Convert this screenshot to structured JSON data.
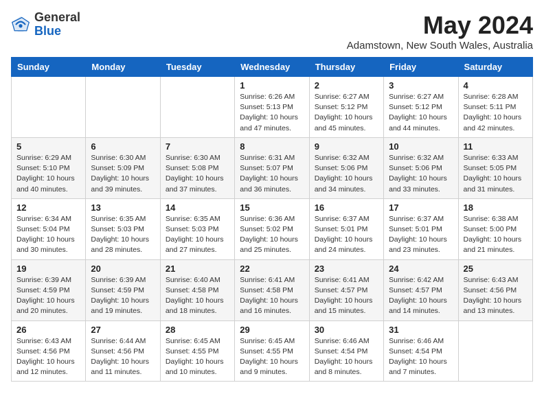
{
  "logo": {
    "general": "General",
    "blue": "Blue"
  },
  "title": {
    "month_year": "May 2024",
    "location": "Adamstown, New South Wales, Australia"
  },
  "headers": [
    "Sunday",
    "Monday",
    "Tuesday",
    "Wednesday",
    "Thursday",
    "Friday",
    "Saturday"
  ],
  "weeks": [
    [
      {
        "num": "",
        "info": ""
      },
      {
        "num": "",
        "info": ""
      },
      {
        "num": "",
        "info": ""
      },
      {
        "num": "1",
        "info": "Sunrise: 6:26 AM\nSunset: 5:13 PM\nDaylight: 10 hours and 47 minutes."
      },
      {
        "num": "2",
        "info": "Sunrise: 6:27 AM\nSunset: 5:12 PM\nDaylight: 10 hours and 45 minutes."
      },
      {
        "num": "3",
        "info": "Sunrise: 6:27 AM\nSunset: 5:12 PM\nDaylight: 10 hours and 44 minutes."
      },
      {
        "num": "4",
        "info": "Sunrise: 6:28 AM\nSunset: 5:11 PM\nDaylight: 10 hours and 42 minutes."
      }
    ],
    [
      {
        "num": "5",
        "info": "Sunrise: 6:29 AM\nSunset: 5:10 PM\nDaylight: 10 hours and 40 minutes."
      },
      {
        "num": "6",
        "info": "Sunrise: 6:30 AM\nSunset: 5:09 PM\nDaylight: 10 hours and 39 minutes."
      },
      {
        "num": "7",
        "info": "Sunrise: 6:30 AM\nSunset: 5:08 PM\nDaylight: 10 hours and 37 minutes."
      },
      {
        "num": "8",
        "info": "Sunrise: 6:31 AM\nSunset: 5:07 PM\nDaylight: 10 hours and 36 minutes."
      },
      {
        "num": "9",
        "info": "Sunrise: 6:32 AM\nSunset: 5:06 PM\nDaylight: 10 hours and 34 minutes."
      },
      {
        "num": "10",
        "info": "Sunrise: 6:32 AM\nSunset: 5:06 PM\nDaylight: 10 hours and 33 minutes."
      },
      {
        "num": "11",
        "info": "Sunrise: 6:33 AM\nSunset: 5:05 PM\nDaylight: 10 hours and 31 minutes."
      }
    ],
    [
      {
        "num": "12",
        "info": "Sunrise: 6:34 AM\nSunset: 5:04 PM\nDaylight: 10 hours and 30 minutes."
      },
      {
        "num": "13",
        "info": "Sunrise: 6:35 AM\nSunset: 5:03 PM\nDaylight: 10 hours and 28 minutes."
      },
      {
        "num": "14",
        "info": "Sunrise: 6:35 AM\nSunset: 5:03 PM\nDaylight: 10 hours and 27 minutes."
      },
      {
        "num": "15",
        "info": "Sunrise: 6:36 AM\nSunset: 5:02 PM\nDaylight: 10 hours and 25 minutes."
      },
      {
        "num": "16",
        "info": "Sunrise: 6:37 AM\nSunset: 5:01 PM\nDaylight: 10 hours and 24 minutes."
      },
      {
        "num": "17",
        "info": "Sunrise: 6:37 AM\nSunset: 5:01 PM\nDaylight: 10 hours and 23 minutes."
      },
      {
        "num": "18",
        "info": "Sunrise: 6:38 AM\nSunset: 5:00 PM\nDaylight: 10 hours and 21 minutes."
      }
    ],
    [
      {
        "num": "19",
        "info": "Sunrise: 6:39 AM\nSunset: 4:59 PM\nDaylight: 10 hours and 20 minutes."
      },
      {
        "num": "20",
        "info": "Sunrise: 6:39 AM\nSunset: 4:59 PM\nDaylight: 10 hours and 19 minutes."
      },
      {
        "num": "21",
        "info": "Sunrise: 6:40 AM\nSunset: 4:58 PM\nDaylight: 10 hours and 18 minutes."
      },
      {
        "num": "22",
        "info": "Sunrise: 6:41 AM\nSunset: 4:58 PM\nDaylight: 10 hours and 16 minutes."
      },
      {
        "num": "23",
        "info": "Sunrise: 6:41 AM\nSunset: 4:57 PM\nDaylight: 10 hours and 15 minutes."
      },
      {
        "num": "24",
        "info": "Sunrise: 6:42 AM\nSunset: 4:57 PM\nDaylight: 10 hours and 14 minutes."
      },
      {
        "num": "25",
        "info": "Sunrise: 6:43 AM\nSunset: 4:56 PM\nDaylight: 10 hours and 13 minutes."
      }
    ],
    [
      {
        "num": "26",
        "info": "Sunrise: 6:43 AM\nSunset: 4:56 PM\nDaylight: 10 hours and 12 minutes."
      },
      {
        "num": "27",
        "info": "Sunrise: 6:44 AM\nSunset: 4:56 PM\nDaylight: 10 hours and 11 minutes."
      },
      {
        "num": "28",
        "info": "Sunrise: 6:45 AM\nSunset: 4:55 PM\nDaylight: 10 hours and 10 minutes."
      },
      {
        "num": "29",
        "info": "Sunrise: 6:45 AM\nSunset: 4:55 PM\nDaylight: 10 hours and 9 minutes."
      },
      {
        "num": "30",
        "info": "Sunrise: 6:46 AM\nSunset: 4:54 PM\nDaylight: 10 hours and 8 minutes."
      },
      {
        "num": "31",
        "info": "Sunrise: 6:46 AM\nSunset: 4:54 PM\nDaylight: 10 hours and 7 minutes."
      },
      {
        "num": "",
        "info": ""
      }
    ]
  ]
}
